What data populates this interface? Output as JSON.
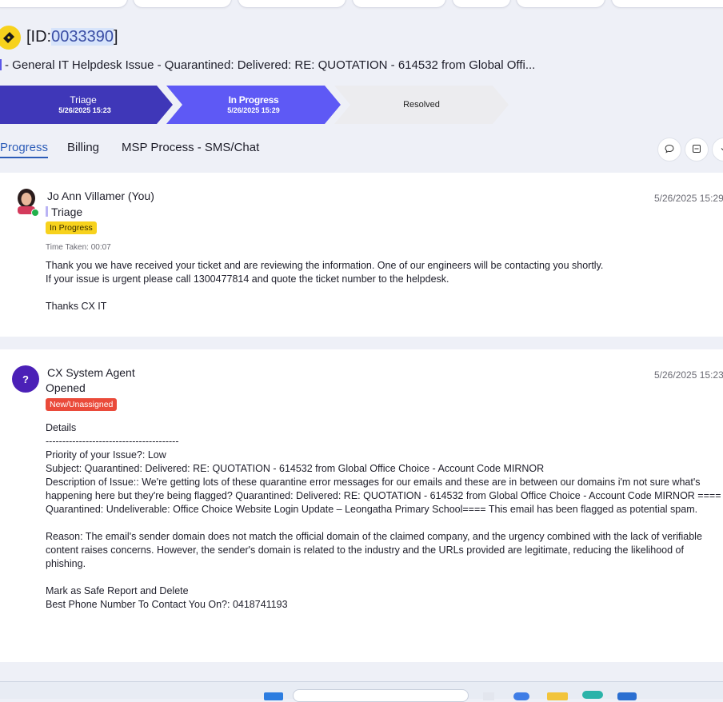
{
  "header": {
    "id_prefix": "[ID:",
    "id_number": "0033390",
    "id_suffix": "]",
    "subject": "- General IT Helpdesk Issue - Quarantined: Delivered: RE: QUOTATION - 614532 from Global Offi..."
  },
  "stages": [
    {
      "name": "Triage",
      "date": "5/26/2025 15:23"
    },
    {
      "name": "In Progress",
      "date": "5/26/2025 15:29"
    },
    {
      "name": "Resolved",
      "date": ""
    }
  ],
  "tabs": [
    "Progress",
    "Billing",
    "MSP Process - SMS/Chat"
  ],
  "entries": [
    {
      "author": "Jo Ann Villamer (You)",
      "status": "Triage",
      "badge": "In Progress",
      "time_taken": "Time Taken: 00:07",
      "timestamp": "5/26/2025 15:29",
      "lines": [
        "Thank you we have received your ticket and are reviewing the information. One of our engineers will be contacting you shortly.",
        "If your issue is urgent please call 1300477814 and quote the ticket number to the helpdesk.",
        "Thanks CX IT"
      ]
    },
    {
      "author": "CX System Agent",
      "status": "Opened",
      "badge": "New/Unassigned",
      "avatar": "?",
      "timestamp": "5/26/2025 15:23",
      "details_label": "Details",
      "divider": "----------------------------------------",
      "priority": "Priority of your Issue?: Low",
      "subject": "Subject: Quarantined: Delivered: RE: QUOTATION - 614532 from Global Office Choice - Account Code MIRNOR",
      "description": "Description of Issue:: We're getting lots of these quarantine error messages for our emails and these are in between our domains i'm not sure what's happening here but they're being flagged? Quarantined: Delivered: RE: QUOTATION - 614532 from Global Office Choice - Account Code MIRNOR ==== Quarantined: Undeliverable: Office Choice Website Login Update – Leongatha Primary School==== This email has been flagged as potential spam.",
      "reason": "Reason: The email's sender domain does not match the official domain of the claimed company, and the urgency combined with the lack of verifiable content raises concerns. However, the sender's domain is related to the industry and the URLs provided are legitimate, reducing the likelihood of phishing.",
      "action": "Mark as Safe Report and Delete",
      "phone": "Best Phone Number To Contact You On?: 0418741193"
    }
  ],
  "colors": {
    "accent": "#5e59f5",
    "stage_done": "#3f37b8",
    "badge_progress": "#f7d21d",
    "badge_new": "#ea4a3a",
    "tab_active": "#2c5cb8"
  },
  "icons": [
    "ticket-icon",
    "comment-icon",
    "collapse-icon",
    "download-icon"
  ]
}
